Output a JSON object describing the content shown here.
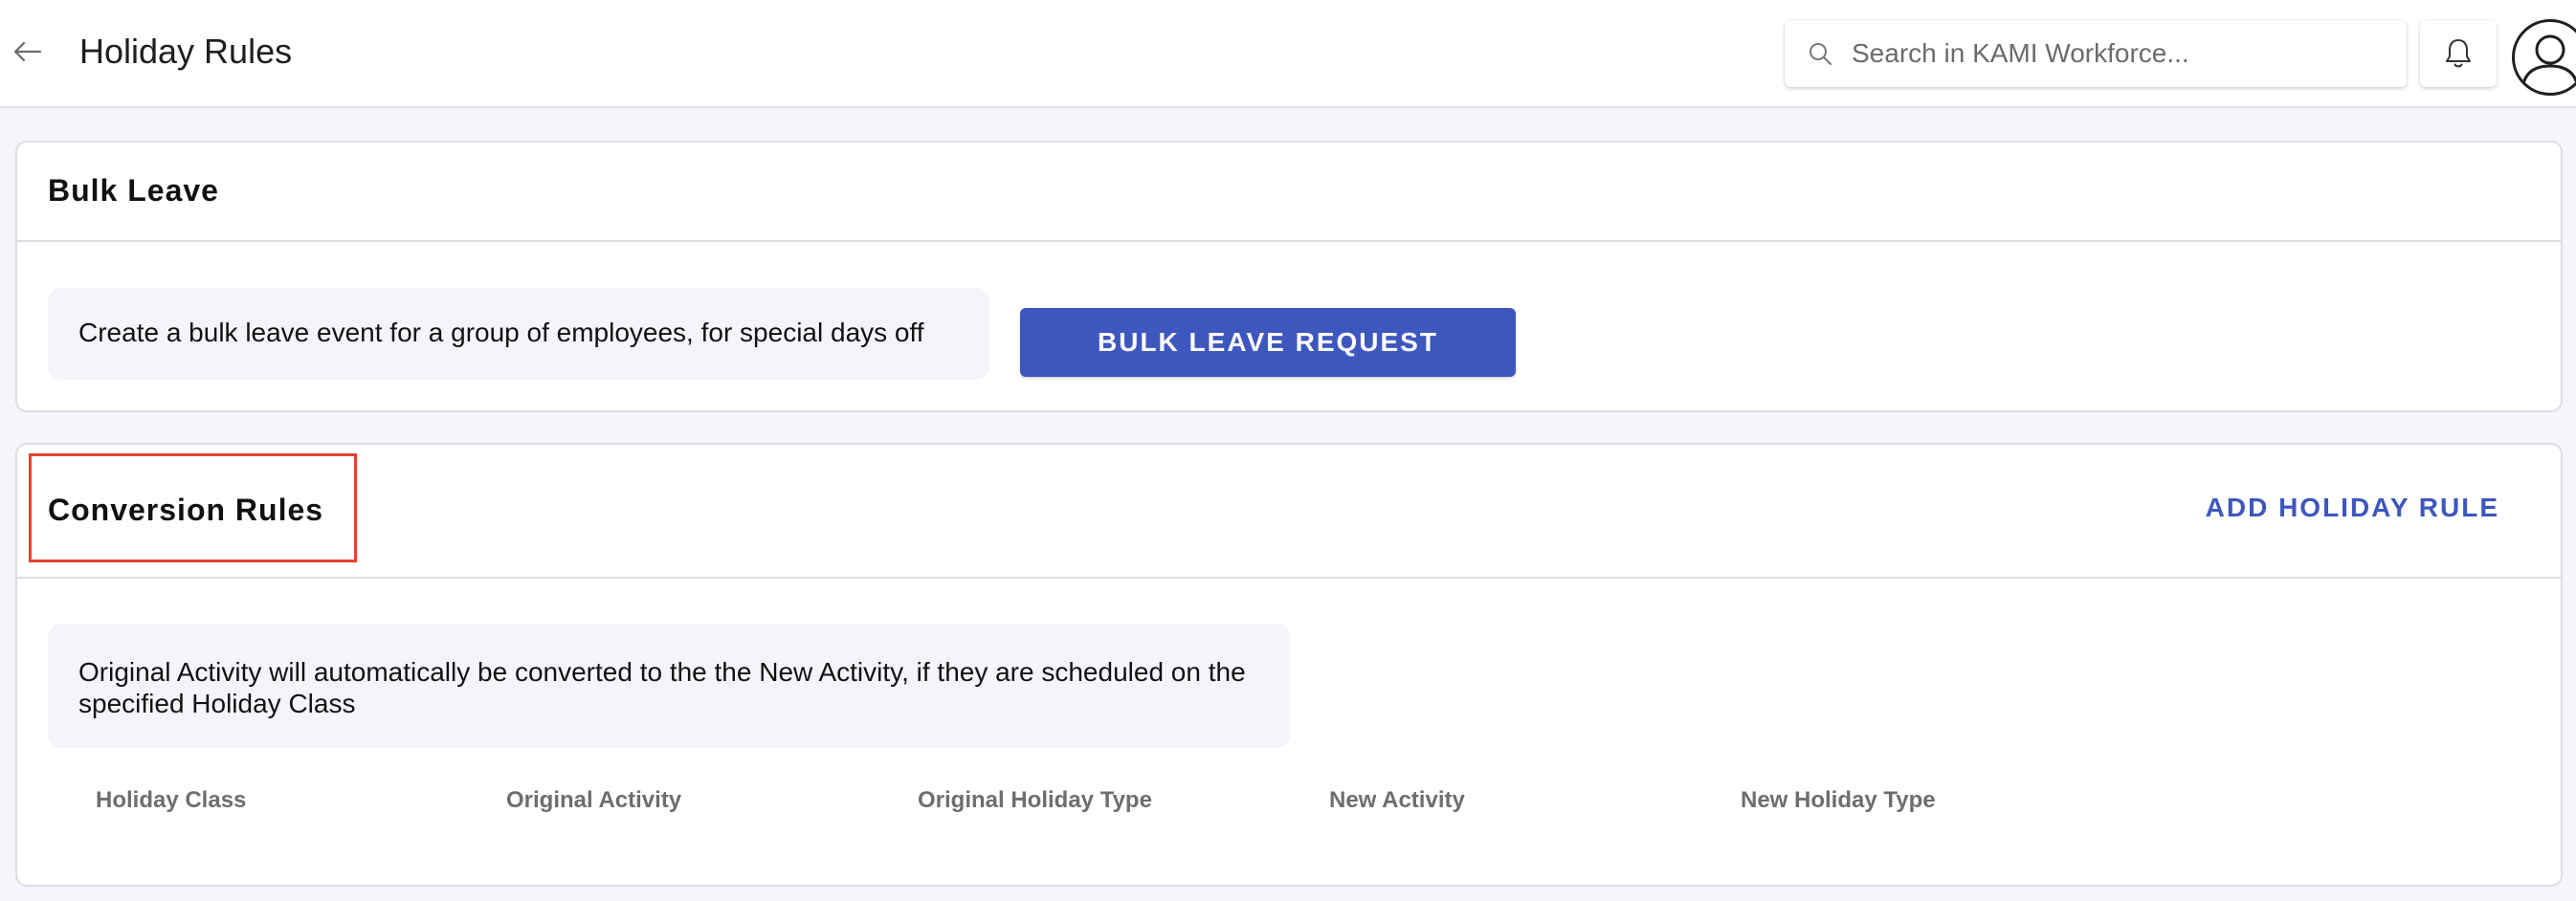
{
  "header": {
    "title": "Holiday Rules",
    "search_placeholder": "Search in KAMI Workforce...",
    "icons": {
      "back": "arrow-left-icon",
      "search": "search-icon",
      "notifications": "bell-icon",
      "profile": "user-avatar-icon"
    }
  },
  "bulk_leave": {
    "title": "Bulk Leave",
    "description": "Create a bulk leave event for a group of employees, for special days off",
    "button_label": "BULK LEAVE REQUEST"
  },
  "conversion_rules": {
    "title": "Conversion Rules",
    "add_button_label": "ADD HOLIDAY RULE",
    "description": "Original Activity will automatically be converted to the the New Activity, if they are scheduled on the specified Holiday Class",
    "columns": [
      "Holiday Class",
      "Original Activity",
      "Original Holiday Type",
      "New Activity",
      "New Holiday Type"
    ]
  },
  "colors": {
    "accent": "#3e57be",
    "highlight": "#e2452a",
    "background": "#f5f6fa"
  }
}
